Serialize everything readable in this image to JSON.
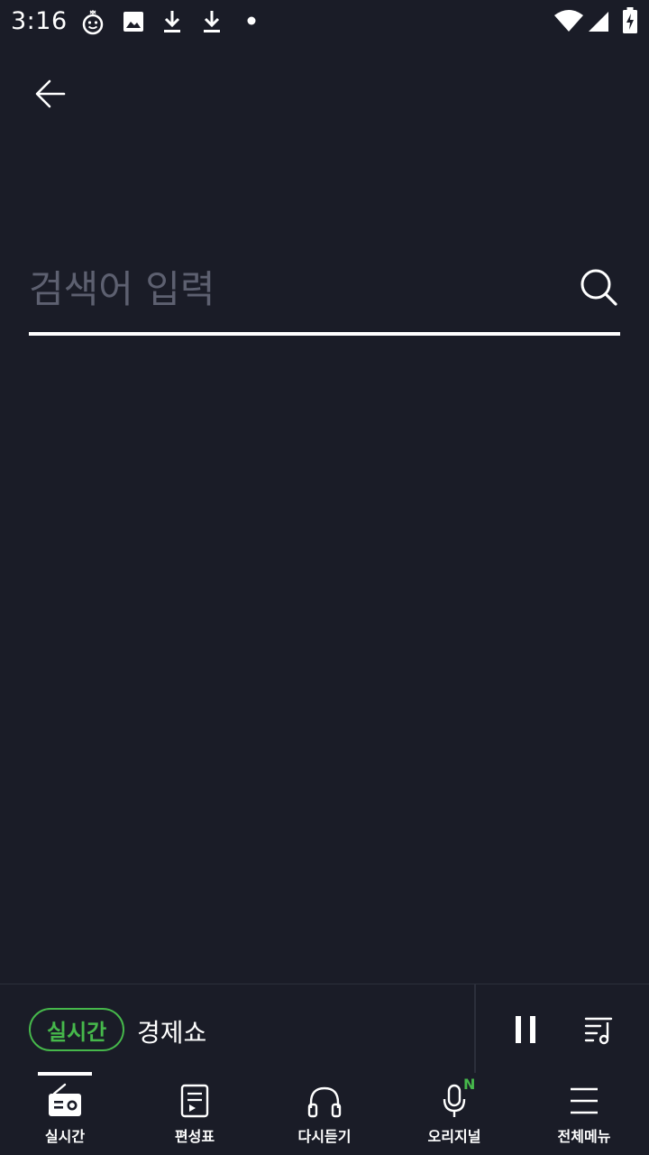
{
  "status_bar": {
    "time": "3:16",
    "icons": [
      "notification-face-icon",
      "image-icon",
      "download-icon",
      "download-icon",
      "dot-icon",
      "wifi-icon",
      "signal-icon",
      "battery-charging-icon"
    ]
  },
  "header": {
    "back_icon": "arrow-left-icon"
  },
  "search": {
    "placeholder": "검색어 입력",
    "value": "",
    "icon": "search-icon"
  },
  "player": {
    "live_badge": "실시간",
    "program_title": "경제쇼",
    "pause_icon": "pause-icon",
    "playlist_icon": "playlist-icon"
  },
  "bottom_nav": {
    "items": [
      {
        "label": "실시간",
        "icon": "radio-icon",
        "active": true
      },
      {
        "label": "편성표",
        "icon": "schedule-icon",
        "active": false
      },
      {
        "label": "다시듣기",
        "icon": "headphones-icon",
        "active": false
      },
      {
        "label": "오리지널",
        "icon": "microphone-icon",
        "active": false,
        "badge": "N"
      },
      {
        "label": "전체메뉴",
        "icon": "menu-icon",
        "active": false
      }
    ]
  },
  "colors": {
    "background": "#1a1c27",
    "accent": "#46b84b",
    "placeholder": "#5d6070",
    "divider": "#2c2f3b"
  }
}
